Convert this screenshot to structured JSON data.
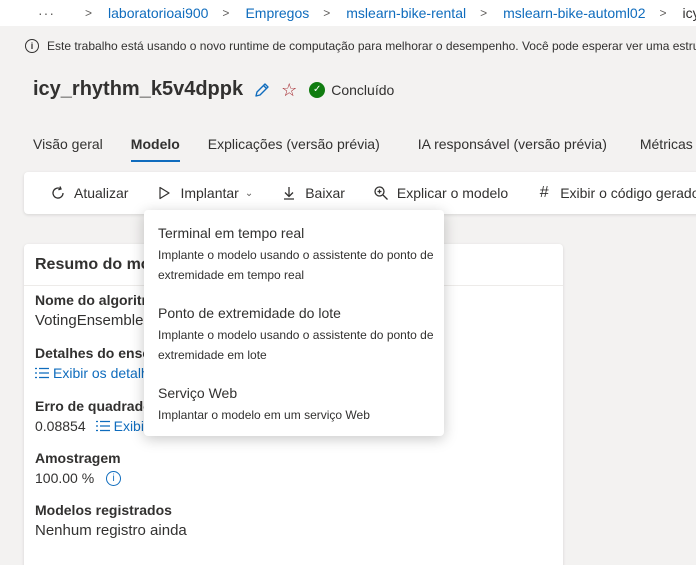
{
  "breadcrumb": {
    "ellipsis": "···",
    "items": [
      "laboratorioai900",
      "Empregos",
      "mslearn-bike-rental",
      "mslearn-bike-automl02"
    ],
    "current": "icy_rh"
  },
  "banner": {
    "text": "Este trabalho está usando o novo runtime de computação para melhorar o desempenho. Você pode esperar ver uma estrutura"
  },
  "run": {
    "title": "icy_rhythm_k5v4dppk",
    "status": "Concluído"
  },
  "tabs": [
    {
      "label": "Visão geral"
    },
    {
      "label": "Modelo"
    },
    {
      "label": "Explicações (versão prévia)"
    },
    {
      "label": "IA responsável (versão prévia)"
    },
    {
      "label": "Métricas"
    }
  ],
  "toolbar": {
    "refresh": "Atualizar",
    "deploy": "Implantar",
    "download": "Baixar",
    "explain": "Explicar o modelo",
    "code": "Exibir o código gerado"
  },
  "summary": {
    "header": "Resumo do modelo",
    "algorithm_label": "Nome do algoritmo",
    "algorithm_value": "VotingEnsemble",
    "ensemble_label": "Detalhes do ensemble",
    "ensemble_link": "Exibir os detalhes do ensemble",
    "error_label": "Erro de quadrado médio",
    "error_value": "0.08854",
    "error_link": "Exibir todas as métricas",
    "sampling_label": "Amostragem",
    "sampling_value": "100.00 %",
    "registered_label": "Modelos registrados",
    "registered_value": "Nenhum registro ainda"
  },
  "deploy_menu": [
    {
      "title": "Terminal em tempo real",
      "description": "Implante o modelo usando o assistente do ponto de extremidade em tempo real"
    },
    {
      "title": "Ponto de extremidade do lote",
      "description": "Implante o modelo usando o assistente do ponto de extremidade em lote"
    },
    {
      "title": "Serviço Web",
      "description": "Implantar o modelo em um serviço Web"
    }
  ]
}
